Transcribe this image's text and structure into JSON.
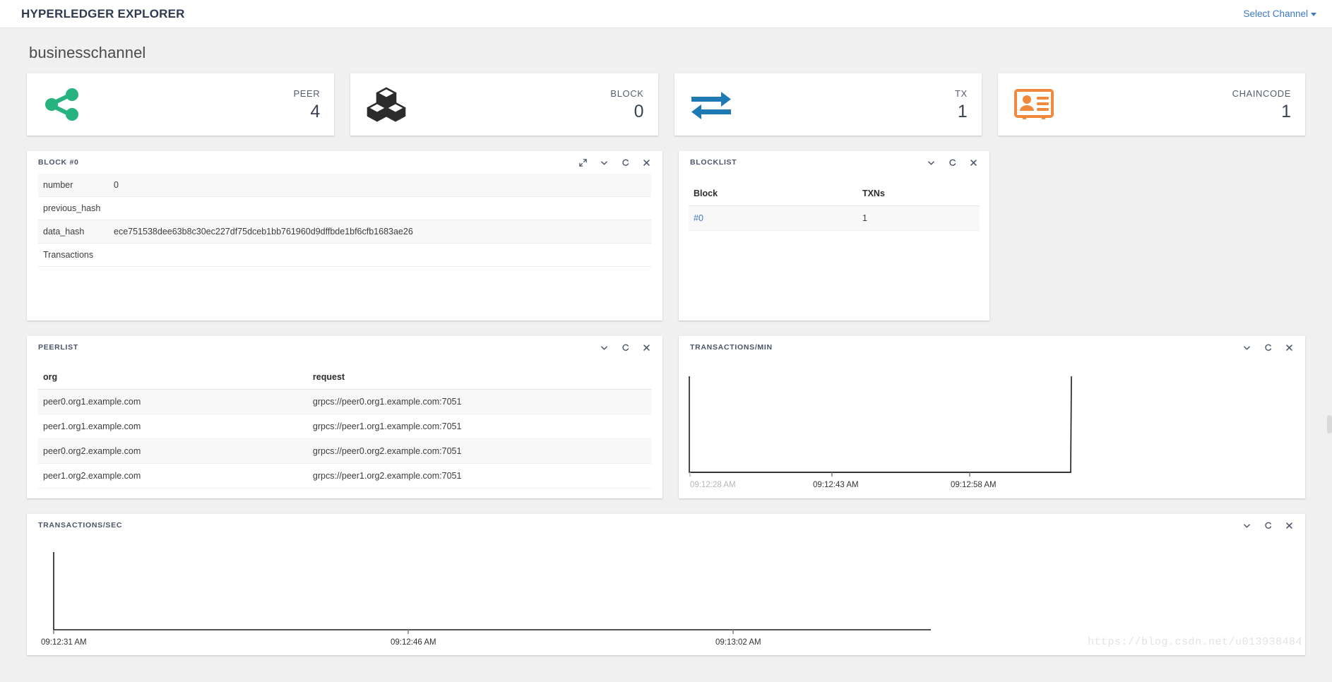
{
  "navbar": {
    "brand": "HYPERLEDGER EXPLORER",
    "channel_select_label": "Select Channel",
    "caret_icon": "caret-down-icon"
  },
  "page": {
    "channel_title": "businesschannel",
    "watermark": "https://blog.csdn.net/u013938484"
  },
  "metrics": [
    {
      "label": "PEER",
      "value": "4",
      "icon": "share-nodes-icon",
      "color": "#26b37f"
    },
    {
      "label": "BLOCK",
      "value": "0",
      "icon": "cubes-icon",
      "color": "#333333"
    },
    {
      "label": "TX",
      "value": "1",
      "icon": "exchange-arrows-icon",
      "color": "#1f7ab4"
    },
    {
      "label": "CHAINCODE",
      "value": "1",
      "icon": "id-card-icon",
      "color": "#f0893b"
    }
  ],
  "panels": {
    "block_detail": {
      "title": "BLOCK #0",
      "tools": [
        "expand-icon",
        "chevron-down-icon",
        "refresh-icon",
        "close-icon"
      ],
      "rows": [
        {
          "key": "number",
          "value": "0"
        },
        {
          "key": "previous_hash",
          "value": ""
        },
        {
          "key": "data_hash",
          "value": "ece751538dee63b8c30ec227df75dceb1bb761960d9dffbde1bf6cfb1683ae26"
        },
        {
          "key": "Transactions",
          "value": ""
        }
      ]
    },
    "blocklist": {
      "title": "BLOCKLIST",
      "tools": [
        "chevron-down-icon",
        "refresh-icon",
        "close-icon"
      ],
      "columns": [
        "Block",
        "TXNs"
      ],
      "rows": [
        {
          "block": "#0",
          "txns": "1"
        }
      ]
    },
    "peerlist": {
      "title": "PEERLIST",
      "tools": [
        "chevron-down-icon",
        "refresh-icon",
        "close-icon"
      ],
      "columns": [
        "org",
        "request"
      ],
      "rows": [
        {
          "org": "peer0.org1.example.com",
          "request": "grpcs://peer0.org1.example.com:7051"
        },
        {
          "org": "peer1.org1.example.com",
          "request": "grpcs://peer1.org1.example.com:7051"
        },
        {
          "org": "peer0.org2.example.com",
          "request": "grpcs://peer0.org2.example.com:7051"
        },
        {
          "org": "peer1.org2.example.com",
          "request": "grpcs://peer1.org2.example.com:7051"
        }
      ]
    },
    "tx_per_min": {
      "title": "TRANSACTIONS/MIN",
      "tools": [
        "chevron-down-icon",
        "refresh-icon",
        "close-icon"
      ]
    },
    "tx_per_sec": {
      "title": "TRANSACTIONS/SEC",
      "tools": [
        "chevron-down-icon",
        "refresh-icon",
        "close-icon"
      ]
    }
  },
  "chart_data": [
    {
      "type": "line",
      "title": "TRANSACTIONS/MIN",
      "xlabel": "",
      "ylabel": "",
      "grid": false,
      "legend": "none",
      "tick_labels": [
        "09:12:28 AM",
        "09:12:43 AM",
        "09:12:58 AM"
      ],
      "x": [
        "09:12:28 AM",
        "09:12:43 AM",
        "09:12:58 AM"
      ],
      "values": [
        1,
        0,
        1
      ],
      "ylim": [
        0,
        1
      ],
      "note": "flat zero baseline with a vertical spike at the left edge and at the right edge"
    },
    {
      "type": "line",
      "title": "TRANSACTIONS/SEC",
      "xlabel": "",
      "ylabel": "",
      "grid": false,
      "legend": "none",
      "tick_labels": [
        "09:12:31 AM",
        "09:12:46 AM",
        "09:13:02 AM"
      ],
      "x": [
        "09:12:31 AM",
        "09:12:46 AM",
        "09:13:02 AM"
      ],
      "values": [
        1,
        0,
        0
      ],
      "ylim": [
        0,
        1
      ],
      "note": "vertical spike at the left edge then a flat zero baseline across the plot"
    }
  ]
}
